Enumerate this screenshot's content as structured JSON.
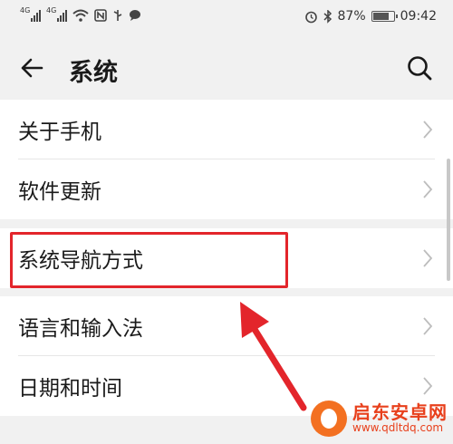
{
  "status_bar": {
    "signal1_label": "4G",
    "signal2_label": "4G",
    "battery_text": "87%",
    "time": "09:42",
    "battery_level": 0.87
  },
  "header": {
    "title": "系统",
    "back_icon": "arrow-left-icon",
    "search_icon": "search-icon"
  },
  "sections": [
    {
      "items": [
        {
          "label": "关于手机"
        },
        {
          "label": "软件更新"
        }
      ]
    },
    {
      "items": [
        {
          "label": "系统导航方式"
        }
      ]
    },
    {
      "items": [
        {
          "label": "语言和输入法"
        },
        {
          "label": "日期和时间"
        }
      ]
    }
  ],
  "annotation": {
    "highlight_color": "#e3252b"
  },
  "watermark": {
    "name": "启东安卓网",
    "url": "www.qdltdq.com"
  }
}
